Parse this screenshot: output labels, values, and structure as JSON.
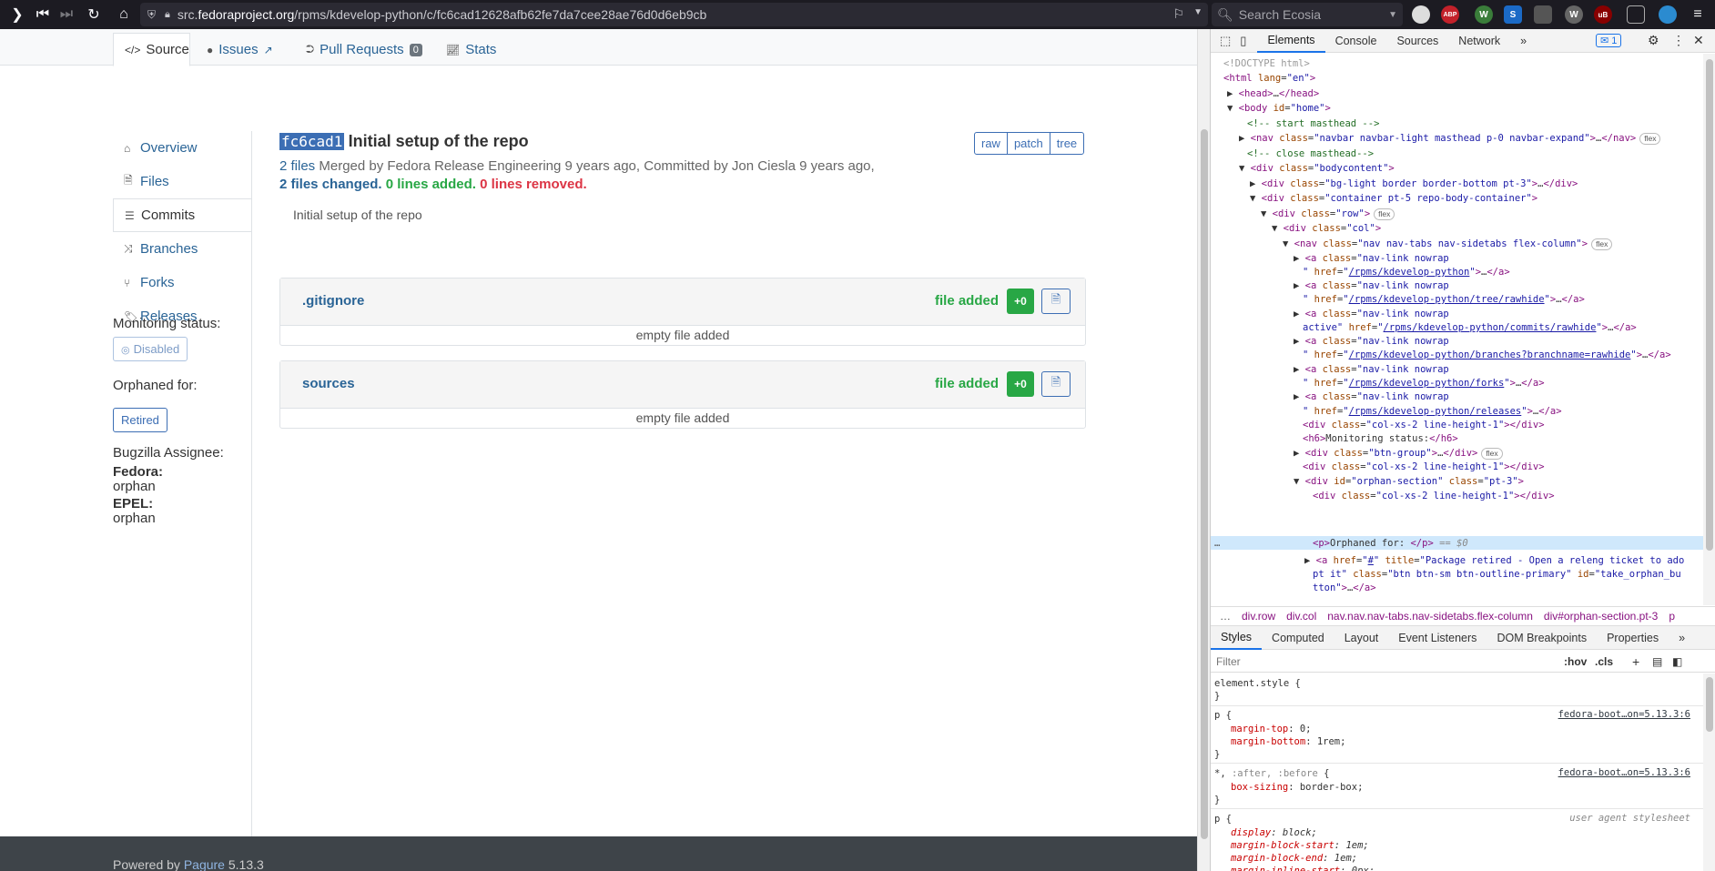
{
  "browser": {
    "url_prefix": "src.",
    "url_host": "fedoraproject.org",
    "url_path": "/rpms/kdevelop-python/c/fc6cad12628afb62fe7da7cee28ae76d0d6eb9cb",
    "search_placeholder": "Search Ecosia",
    "ext_labels": [
      "ABP",
      "W",
      "S",
      "W",
      "uB"
    ]
  },
  "topnav": {
    "source": "Source",
    "issues": "Issues",
    "pull_requests": "Pull Requests",
    "pr_count": "0",
    "stats": "Stats"
  },
  "sidebar": {
    "items": [
      {
        "label": "Overview"
      },
      {
        "label": "Files"
      },
      {
        "label": "Commits"
      },
      {
        "label": "Branches"
      },
      {
        "label": "Forks"
      },
      {
        "label": "Releases"
      }
    ],
    "monitoring_label": "Monitoring status:",
    "monitoring_value": "Disabled",
    "orphaned_label": "Orphaned for:",
    "orphaned_value": "Retired",
    "bugzilla_label": "Bugzilla Assignee:",
    "fedora_label": "Fedora:",
    "fedora_value": "orphan",
    "epel_label": "EPEL:",
    "epel_value": "orphan"
  },
  "commit": {
    "hash": "fc6cad1",
    "title": "Initial setup of the repo",
    "raw": "raw",
    "patch": "patch",
    "tree": "tree",
    "files_count": "2 files",
    "meta_text": " Merged by Fedora Release Engineering 9 years ago, Committed by Jon Ciesla 9 years ago,",
    "files_changed": "2 files changed.",
    "lines_added": "0 lines added.",
    "lines_removed": "0 lines removed.",
    "message": "Initial setup of the repo",
    "files": [
      {
        "name": ".gitignore",
        "status": "file added",
        "delta": "+0",
        "body": "empty file added"
      },
      {
        "name": "sources",
        "status": "file added",
        "delta": "+0",
        "body": "empty file added"
      }
    ]
  },
  "footer": {
    "powered_by": "Powered by ",
    "pagure": "Pagure",
    "version": " 5.13.3"
  },
  "devtools": {
    "tabs": [
      "Elements",
      "Console",
      "Sources",
      "Network"
    ],
    "issues_count": "1",
    "crumbs": [
      "div.row",
      "div.col",
      "nav.nav.nav-tabs.nav-sidetabs.flex-column",
      "div#orphan-section.pt-3",
      "p"
    ],
    "style_tabs": [
      "Styles",
      "Computed",
      "Layout",
      "Event Listeners",
      "DOM Breakpoints",
      "Properties"
    ],
    "filter_placeholder": "Filter",
    "hov": ":hov",
    "cls": ".cls",
    "source_link": "fedora-boot…on=5.13.3:6",
    "ua_label": "user agent stylesheet",
    "selected_suffix": "== $0"
  }
}
